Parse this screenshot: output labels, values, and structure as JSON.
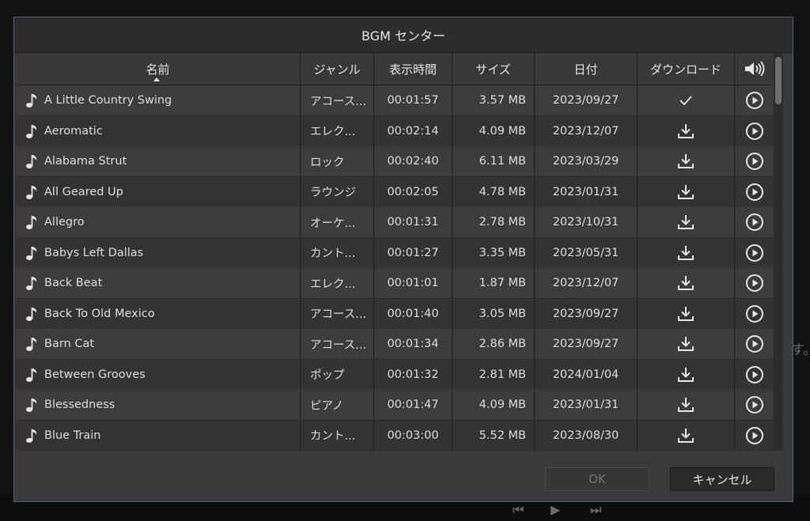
{
  "background": {
    "right_text": "す。",
    "transport": {
      "prev": "⏮",
      "play": "▶",
      "next": "⏭"
    }
  },
  "dialog": {
    "title": "BGM センター",
    "columns": {
      "name": "名前",
      "genre": "ジャンル",
      "duration": "表示時間",
      "size": "サイズ",
      "date": "日付",
      "download": "ダウンロード",
      "volume_icon": "volume-icon"
    },
    "rows": [
      {
        "name": "A Little Country Swing",
        "genre": "アコース...",
        "duration": "00:01:57",
        "size": "3.57 MB",
        "date": "2023/09/27",
        "downloaded": true
      },
      {
        "name": "Aeromatic",
        "genre": "エレク...",
        "duration": "00:02:14",
        "size": "4.09 MB",
        "date": "2023/12/07",
        "downloaded": false
      },
      {
        "name": "Alabama Strut",
        "genre": "ロック",
        "duration": "00:02:40",
        "size": "6.11 MB",
        "date": "2023/03/29",
        "downloaded": false
      },
      {
        "name": "All Geared Up",
        "genre": "ラウンジ",
        "duration": "00:02:05",
        "size": "4.78 MB",
        "date": "2023/01/31",
        "downloaded": false
      },
      {
        "name": "Allegro",
        "genre": "オーケ...",
        "duration": "00:01:31",
        "size": "2.78 MB",
        "date": "2023/10/31",
        "downloaded": false
      },
      {
        "name": "Babys Left Dallas",
        "genre": "カント...",
        "duration": "00:01:27",
        "size": "3.35 MB",
        "date": "2023/05/31",
        "downloaded": false
      },
      {
        "name": "Back Beat",
        "genre": "エレク...",
        "duration": "00:01:01",
        "size": "1.87 MB",
        "date": "2023/12/07",
        "downloaded": false
      },
      {
        "name": "Back To Old Mexico",
        "genre": "アコース...",
        "duration": "00:01:40",
        "size": "3.05 MB",
        "date": "2023/09/27",
        "downloaded": false
      },
      {
        "name": "Barn Cat",
        "genre": "アコース...",
        "duration": "00:01:34",
        "size": "2.86 MB",
        "date": "2023/09/27",
        "downloaded": false
      },
      {
        "name": "Between Grooves",
        "genre": "ポップ",
        "duration": "00:01:32",
        "size": "2.81 MB",
        "date": "2024/01/04",
        "downloaded": false
      },
      {
        "name": "Blessedness",
        "genre": "ピアノ",
        "duration": "00:01:47",
        "size": "4.09 MB",
        "date": "2023/01/31",
        "downloaded": false
      },
      {
        "name": "Blue Train",
        "genre": "カント...",
        "duration": "00:03:00",
        "size": "5.52 MB",
        "date": "2023/08/30",
        "downloaded": false
      }
    ],
    "buttons": {
      "ok": "OK",
      "cancel": "キャンセル"
    }
  }
}
